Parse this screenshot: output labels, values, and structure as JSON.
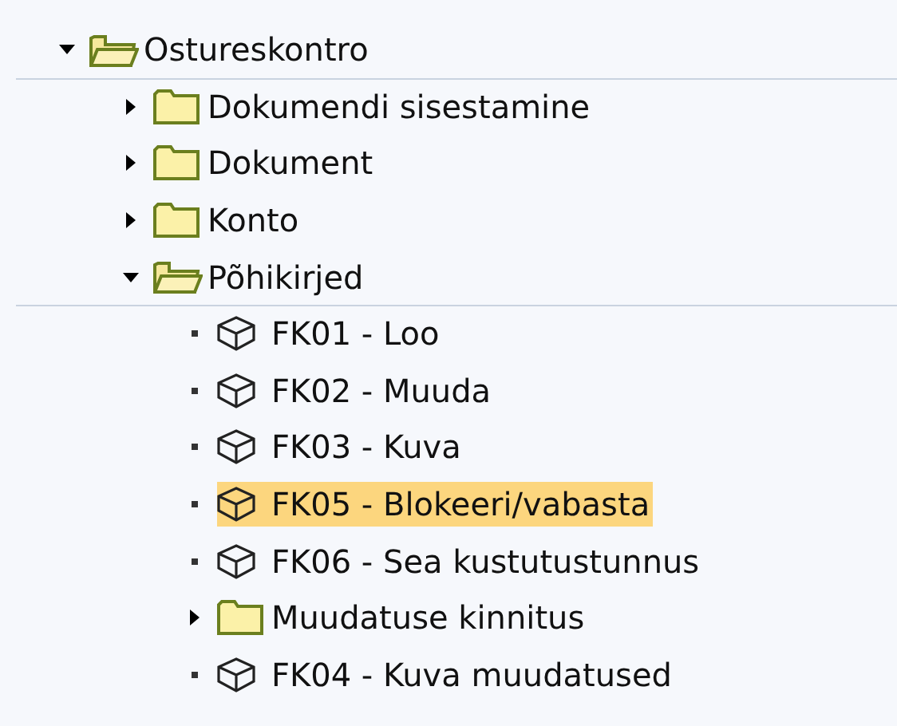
{
  "tree": [
    {
      "kind": "folder",
      "label": "Ostureskontro",
      "expanded": true,
      "selected": false,
      "children": [
        {
          "kind": "folder",
          "label": "Dokumendi sisestamine",
          "expanded": false,
          "selected": false
        },
        {
          "kind": "folder",
          "label": "Dokument",
          "expanded": false,
          "selected": false
        },
        {
          "kind": "folder",
          "label": "Konto",
          "expanded": false,
          "selected": false
        },
        {
          "kind": "folder",
          "label": "Põhikirjed",
          "expanded": true,
          "selected": false,
          "children": [
            {
              "kind": "transaction",
              "label": "FK01 - Loo",
              "selected": false
            },
            {
              "kind": "transaction",
              "label": "FK02 - Muuda",
              "selected": false
            },
            {
              "kind": "transaction",
              "label": "FK03 - Kuva",
              "selected": false
            },
            {
              "kind": "transaction",
              "label": "FK05 - Blokeeri/vabasta",
              "selected": true
            },
            {
              "kind": "transaction",
              "label": "FK06 - Sea kustutustunnus",
              "selected": false
            },
            {
              "kind": "folder",
              "label": "Muudatuse kinnitus",
              "expanded": false,
              "selected": false
            },
            {
              "kind": "transaction",
              "label": "FK04 - Kuva muudatused",
              "selected": false
            }
          ]
        }
      ]
    }
  ]
}
